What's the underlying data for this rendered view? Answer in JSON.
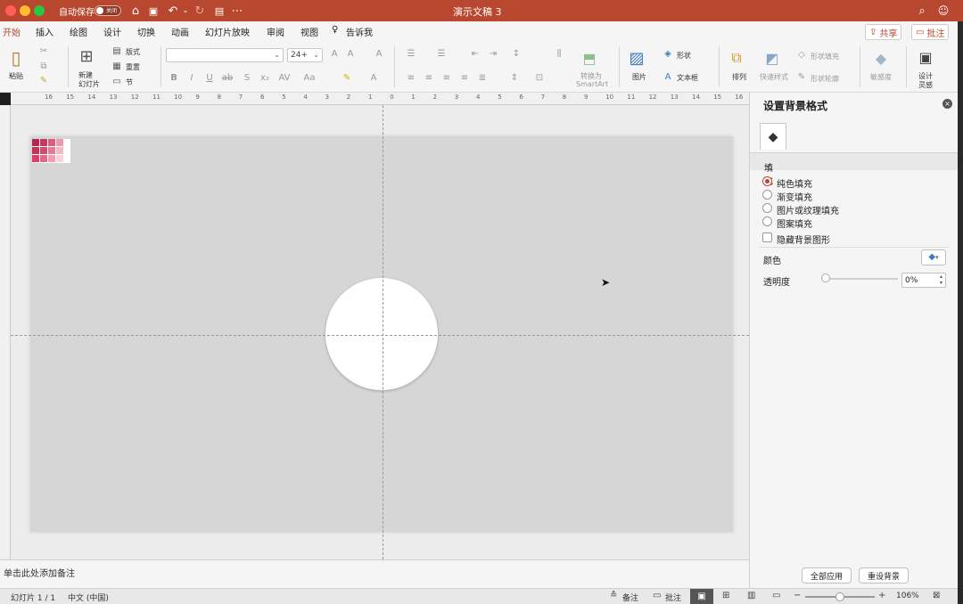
{
  "titlebar": {
    "autosave_label": "自动保存",
    "autosave_state": "关闭",
    "doc_title": "演示文稿 3",
    "bg_color": "#b8472f"
  },
  "tabs": [
    {
      "label": "开始",
      "active": true
    },
    {
      "label": "插入"
    },
    {
      "label": "绘图"
    },
    {
      "label": "设计"
    },
    {
      "label": "切换"
    },
    {
      "label": "动画"
    },
    {
      "label": "幻灯片放映"
    },
    {
      "label": "审阅"
    },
    {
      "label": "视图"
    },
    {
      "label": "告诉我"
    }
  ],
  "top_buttons": {
    "share": "共享",
    "comment": "批注"
  },
  "ribbon": {
    "paste": "粘贴",
    "new_slide_line1": "新建",
    "new_slide_line2": "幻灯片",
    "layout": "版式",
    "reset": "重置",
    "section": "节",
    "font_size": "24+",
    "convert_line1": "转换为",
    "convert_line2": "SmartArt",
    "picture": "图片",
    "shape": "形状",
    "textbox": "文本框",
    "arrange": "排列",
    "quick_styles": "快速样式",
    "shape_fill": "形状填充",
    "shape_outline": "形状轮廓",
    "sensitivity": "敏感度",
    "designer_line1": "设计",
    "designer_line2": "灵感"
  },
  "ruler_labels": [
    "16",
    "15",
    "14",
    "13",
    "12",
    "11",
    "10",
    "9",
    "8",
    "7",
    "6",
    "5",
    "4",
    "3",
    "2",
    "1",
    "0",
    "1",
    "2",
    "3",
    "4",
    "5",
    "6",
    "7",
    "8",
    "9",
    "10",
    "11",
    "12",
    "13",
    "14",
    "15",
    "16"
  ],
  "notes": {
    "placeholder": "单击此处添加备注"
  },
  "pane": {
    "title": "设置背景格式",
    "section": "填充",
    "options": [
      {
        "label": "纯色填充",
        "selected": true
      },
      {
        "label": "渐变填充",
        "selected": false
      },
      {
        "label": "图片或纹理填充",
        "selected": false
      },
      {
        "label": "图案填充",
        "selected": false
      }
    ],
    "hide_bg_graphics": "隐藏背景图形",
    "color_label": "颜色",
    "transparency_label": "透明度",
    "transparency_value": "0%",
    "transparency_level": 0,
    "apply_all": "全部应用",
    "reset_bg": "重设背景"
  },
  "status": {
    "slide_count": "幻灯片 1 / 1",
    "language": "中文 (中国)",
    "notes": "备注",
    "comments": "批注",
    "zoom": "106%"
  },
  "palette_colors": [
    "#b0284f",
    "#c23a5f",
    "#d4607e",
    "#e89aae",
    "#c43459",
    "#d24a6c",
    "#e07d96",
    "#f0b8c6",
    "#d44066",
    "#e06a86",
    "#ec9fb1",
    "#f7d3dc"
  ]
}
